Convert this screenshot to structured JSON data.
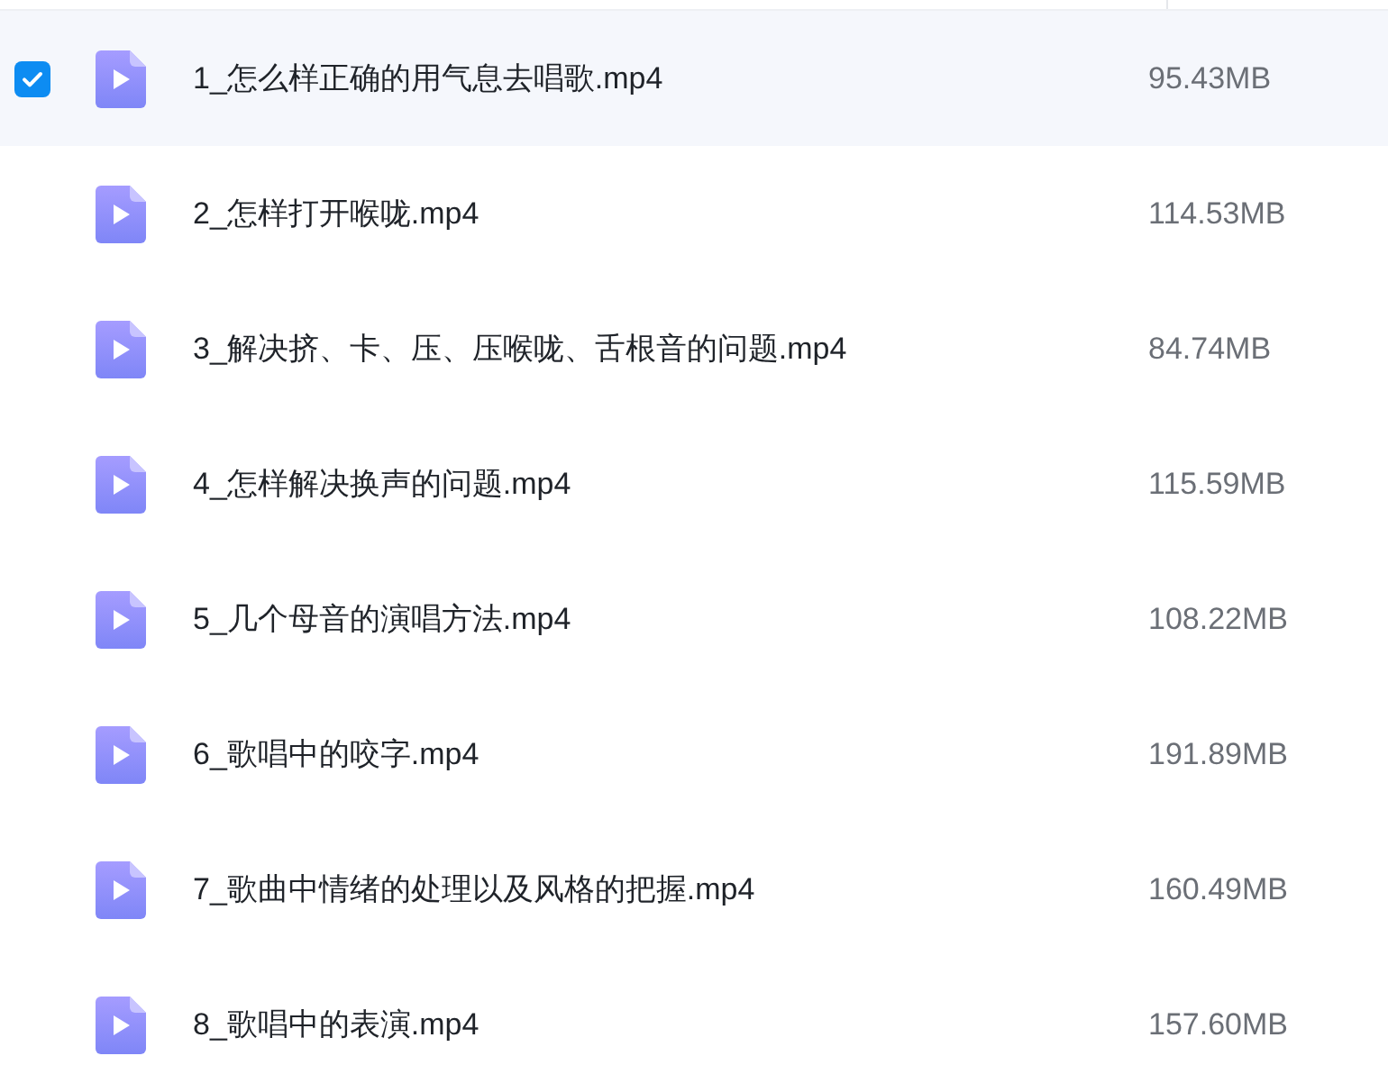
{
  "files": [
    {
      "name": "1_怎么样正确的用气息去唱歌.mp4",
      "size": "95.43MB",
      "selected": true
    },
    {
      "name": "2_怎样打开喉咙.mp4",
      "size": "114.53MB",
      "selected": false
    },
    {
      "name": "3_解决挤、卡、压、压喉咙、舌根音的问题.mp4",
      "size": "84.74MB",
      "selected": false
    },
    {
      "name": "4_怎样解决换声的问题.mp4",
      "size": "115.59MB",
      "selected": false
    },
    {
      "name": "5_几个母音的演唱方法.mp4",
      "size": "108.22MB",
      "selected": false
    },
    {
      "name": "6_歌唱中的咬字.mp4",
      "size": "191.89MB",
      "selected": false
    },
    {
      "name": "7_歌曲中情绪的处理以及风格的把握.mp4",
      "size": "160.49MB",
      "selected": false
    },
    {
      "name": "8_歌唱中的表演.mp4",
      "size": "157.60MB",
      "selected": false
    }
  ]
}
